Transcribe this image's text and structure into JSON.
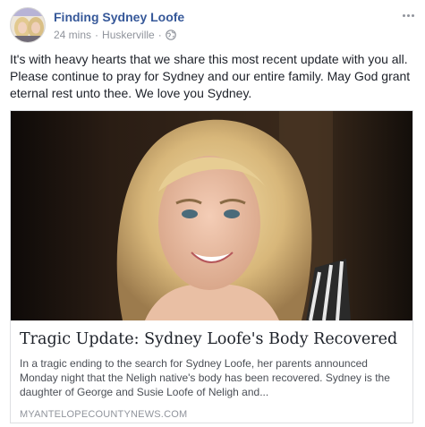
{
  "post": {
    "page_name": "Finding Sydney Loofe",
    "timestamp": "24 mins",
    "location": "Huskerville",
    "separator": "·",
    "privacy_icon": "globe-icon",
    "more_icon": "more-options-icon",
    "text": "It's with heavy hearts that we share this most recent update with you all. Please continue to pray for Sydney and our entire family. May God grant eternal rest unto thee. We love you Sydney."
  },
  "link": {
    "title": "Tragic Update: Sydney Loofe's Body Recovered",
    "description": "In a tragic ending to the search for Sydney Loofe, her parents announced Monday night that the Neligh native's body has been recovered. Sydney is the daughter of George and Susie Loofe of Neligh and...",
    "domain": "MYANTELOPECOUNTYNEWS.COM",
    "image_icon": "article-photo"
  },
  "colors": {
    "page_name": "#365899",
    "meta": "#90949c",
    "text": "#1d2129",
    "card_border": "#dddfe2"
  }
}
